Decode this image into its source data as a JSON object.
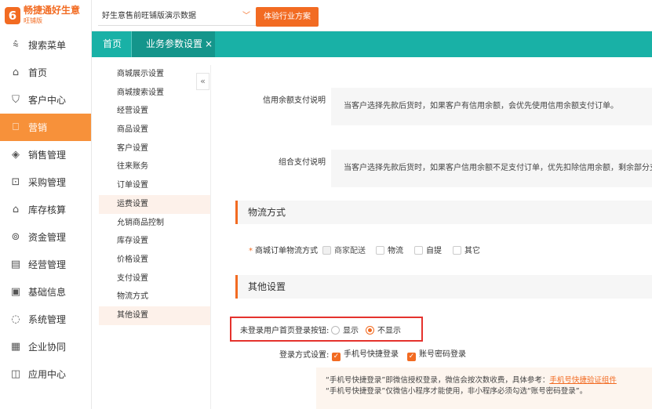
{
  "brand": {
    "logo_letter": "6",
    "name": "畅捷通好生意",
    "edition": "旺铺版"
  },
  "topbar": {
    "company": "好生意售前旺铺版演示数据",
    "try_button": "体验行业方案"
  },
  "sidebar": {
    "items": [
      {
        "label": "搜索菜单",
        "icon": "search-menu-icon",
        "glyph": "⩯"
      },
      {
        "label": "首页",
        "icon": "home-icon",
        "glyph": "⌂"
      },
      {
        "label": "客户中心",
        "icon": "shield-icon",
        "glyph": "⛉"
      },
      {
        "label": "营销",
        "icon": "gift-icon",
        "glyph": "⎕"
      },
      {
        "label": "销售管理",
        "icon": "sales-icon",
        "glyph": "◈"
      },
      {
        "label": "采购管理",
        "icon": "briefcase-icon",
        "glyph": "⊡"
      },
      {
        "label": "库存核算",
        "icon": "warehouse-icon",
        "glyph": "⌂"
      },
      {
        "label": "资金管理",
        "icon": "money-icon",
        "glyph": "⊚"
      },
      {
        "label": "经营管理",
        "icon": "report-icon",
        "glyph": "▤"
      },
      {
        "label": "基础信息",
        "icon": "info-icon",
        "glyph": "▣"
      },
      {
        "label": "系统管理",
        "icon": "settings-icon",
        "glyph": "◌"
      },
      {
        "label": "企业协同",
        "icon": "cooperation-icon",
        "glyph": "▦"
      },
      {
        "label": "应用中心",
        "icon": "app-icon",
        "glyph": "◫"
      }
    ]
  },
  "tabs": {
    "home": "首页",
    "active": "业务参数设置",
    "close": "×"
  },
  "settings_nav": {
    "collapse": "«",
    "items": [
      "商城展示设置",
      "商城搜索设置",
      "经营设置",
      "商品设置",
      "客户设置",
      "往来账务",
      "订单设置",
      "运费设置",
      "允销商品控制",
      "库存设置",
      "价格设置",
      "支付设置",
      "物流方式",
      "其他设置"
    ]
  },
  "credit": {
    "label": "信用余额支付说明",
    "desc": "当客户选择先款后货时，如果客户有信用余额，会优先使用信用余额支付订单。"
  },
  "combo": {
    "label": "组合支付说明",
    "desc": "当客户选择先款后货时，如果客户信用余额不足支付订单，优先扣除信用余额，剩余部分支持第三方支付。"
  },
  "logistics": {
    "section_title": "物流方式",
    "label": "商城订单物流方式",
    "options": [
      "商家配送",
      "物流",
      "自提",
      "其它"
    ]
  },
  "other": {
    "section_title": "其他设置",
    "login_btn_label": "未登录用户首页登录按钮:",
    "show": "显示",
    "hide": "不显示",
    "login_method_label": "登录方式设置:",
    "phone_login": "手机号快捷登录",
    "account_login": "账号密码登录",
    "note_line1": "“手机号快捷登录”即微信授权登录，微信会按次数收费，具体参考：",
    "note_link": "手机号快捷验证组件",
    "note_line2": "“手机号快捷登录”仅微信小程序才能使用，非小程序必须勾选“账号密码登录”。"
  },
  "colors": {
    "accent": "#f26b22",
    "teal": "#19b1a6",
    "highlight_box": "#e5322d"
  }
}
